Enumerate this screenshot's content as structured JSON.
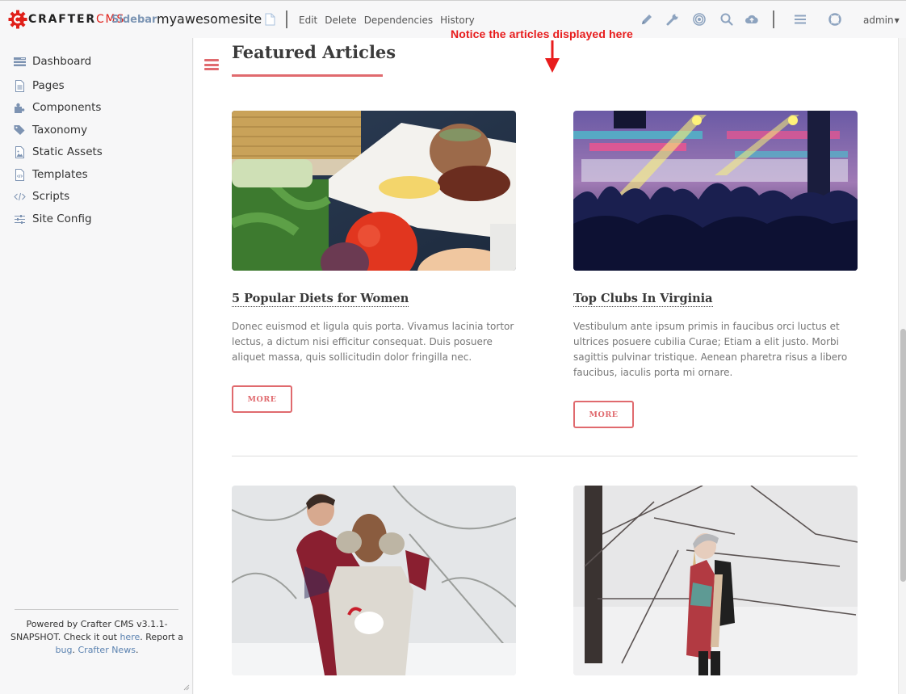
{
  "toolbar": {
    "logo_text_main": "CRAFTER",
    "logo_text_accent": "CMS",
    "sidebar_toggle": "Sidebar",
    "site_name": "myawesomesite",
    "actions": [
      "Edit",
      "Delete",
      "Dependencies",
      "History"
    ],
    "icons": [
      "pencil-icon",
      "wrench-icon",
      "target-icon",
      "search-icon",
      "cloud-upload-icon",
      "menu-icon",
      "lifebuoy-icon"
    ],
    "user": "admin"
  },
  "annotation": {
    "text": "Notice the articles displayed here",
    "color": "#e81c1c"
  },
  "sidebar": {
    "items": [
      {
        "label": "Dashboard",
        "icon": "dashboard-icon"
      },
      {
        "label": "Pages",
        "icon": "page-icon"
      },
      {
        "label": "Components",
        "icon": "puzzle-icon"
      },
      {
        "label": "Taxonomy",
        "icon": "tag-icon"
      },
      {
        "label": "Static Assets",
        "icon": "image-icon"
      },
      {
        "label": "Templates",
        "icon": "template-file-icon"
      },
      {
        "label": "Scripts",
        "icon": "code-icon"
      },
      {
        "label": "Site Config",
        "icon": "sliders-icon"
      }
    ],
    "footer": {
      "text_1": "Powered by Crafter CMS v3.1.1-SNAPSHOT. Check it out ",
      "link_here": "here",
      "text_2": ". Report a ",
      "link_bug": "bug",
      "text_3": ". ",
      "link_news": "Crafter News",
      "text_4": "."
    }
  },
  "main": {
    "section_title": "Featured Articles",
    "accent_color": "#e06a6e",
    "articles": [
      {
        "title": "5 Popular Diets for Women",
        "summary": "Donec euismod et ligula quis porta. Vivamus lacinia tortor lectus, a dictum nisi efficitur consequat. Duis posuere aliquet massa, quis sollicitudin dolor fringilla nec.",
        "button": "MORE",
        "image": "food-plate-photo"
      },
      {
        "title": "Top Clubs In Virginia",
        "summary": "Vestibulum ante ipsum primis in faucibus orci luctus et ultrices posuere cubilia Curae; Etiam a elit justo. Morbi sagittis pulvinar tristique. Aenean pharetra risus a libero faucibus, iaculis porta mi ornare.",
        "button": "MORE",
        "image": "nightclub-crowd-photo"
      },
      {
        "title": "",
        "summary": "",
        "button": "",
        "image": "winter-couple-photo"
      },
      {
        "title": "",
        "summary": "",
        "button": "",
        "image": "winter-woman-photo"
      }
    ]
  }
}
